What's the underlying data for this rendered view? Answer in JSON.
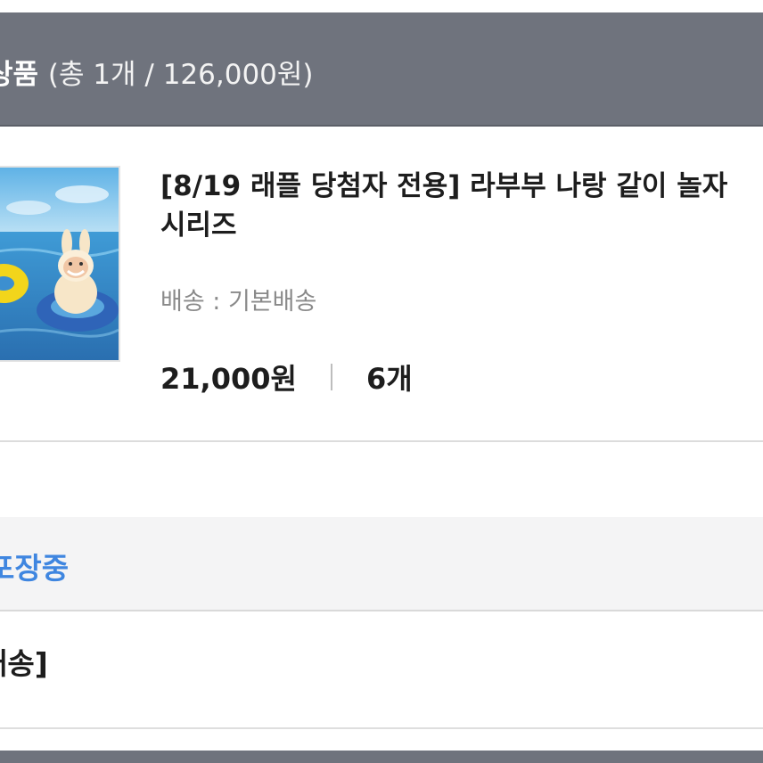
{
  "order_section": {
    "title": "상품",
    "summary": "(총 1개 / 126,000원)"
  },
  "product": {
    "name_line1": "[8/19 래플 당첨자 전용] 라부부 나랑 같이 놀자",
    "name_line2": "시리즈",
    "shipping": "배송 : 기본배송",
    "price": "21,000원",
    "quantity": "6개",
    "image_icon": "labubu-figure-pool-image"
  },
  "status": {
    "text": "포장중",
    "color": "#3f86e0"
  },
  "delivery": {
    "label": "배송]"
  },
  "colors": {
    "header_bg": "#6f737d",
    "status_bg": "#f4f4f5"
  }
}
